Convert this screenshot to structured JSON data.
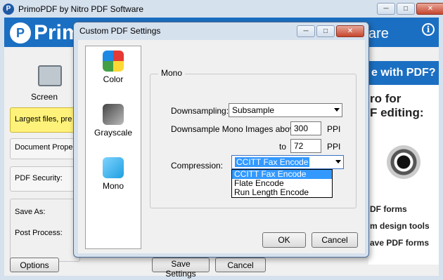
{
  "app": {
    "title": "PrimoPDF by Nitro PDF Software",
    "icon_letter": "P",
    "banner_word": "Primo",
    "banner_tail": "are",
    "info": "i"
  },
  "left": {
    "screen_label": "Screen",
    "items": [
      "Largest files, pre",
      "Document Prope",
      "PDF Security:"
    ],
    "save_as": "Save As:",
    "post_process": "Post Process:"
  },
  "ad": {
    "headline": "e with PDF?",
    "line1": "ro for",
    "line2": "F editing:",
    "features": [
      "DF forms",
      "m design tools",
      "ave PDF forms"
    ]
  },
  "bottom": {
    "options": "Options",
    "save_settings": "Save Settings",
    "cancel": "Cancel"
  },
  "dialog": {
    "title": "Custom PDF Settings",
    "categories": [
      "Color",
      "Grayscale",
      "Mono"
    ],
    "group": "Mono",
    "downsampling_label": "Downsampling:",
    "downsampling_value": "Subsample",
    "above_label": "Downsample Mono Images above",
    "above_value": "300",
    "to_label": "to",
    "to_value": "72",
    "ppi": "PPI",
    "compression_label": "Compression:",
    "compression_value": "CCITT Fax Encode",
    "compression_options": [
      "CCITT Fax Encode",
      "Flate Encode",
      "Run Length Encode"
    ],
    "ok": "OK",
    "cancel": "Cancel"
  },
  "colors": {
    "banner": "#1b6fc2",
    "selected_item": "#fff27a",
    "highlight": "#3399ff"
  },
  "icons": [
    "app-icon",
    "minimize-icon",
    "maximize-icon",
    "close-icon",
    "info-icon",
    "monitor-icon",
    "color-dropper-icon",
    "grayscale-dropper-icon",
    "mono-dropper-icon",
    "dropdown-arrow-icon"
  ]
}
